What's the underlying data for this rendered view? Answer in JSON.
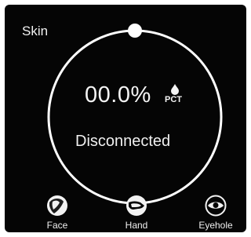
{
  "panel": {
    "title": "Skin"
  },
  "gauge": {
    "value_text": "00.0%",
    "unit_label": "PCT",
    "status": "Disconnected",
    "progress_fraction": 0.0
  },
  "modes": [
    {
      "label": "Face",
      "icon": "face-icon"
    },
    {
      "label": "Hand",
      "icon": "hand-icon"
    },
    {
      "label": "Eyehole",
      "icon": "eye-icon"
    }
  ],
  "colors": {
    "background": "#050505",
    "ring": "#ffffff",
    "text": "#f0f0f0"
  }
}
